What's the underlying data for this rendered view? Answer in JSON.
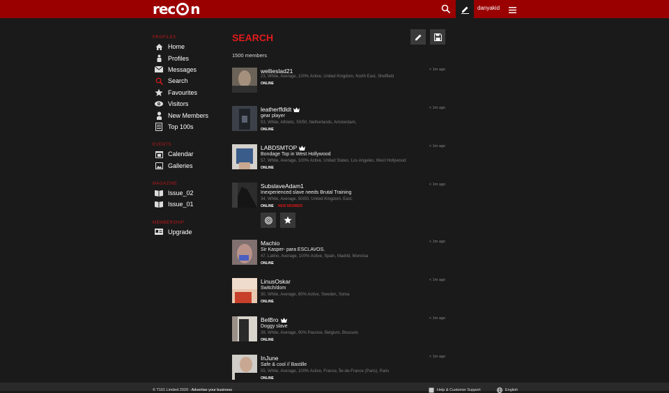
{
  "header": {
    "logo_text": "recon",
    "username": "danyakid"
  },
  "sidebar": {
    "sections": [
      {
        "title": "PROFILES",
        "items": [
          {
            "label": "Home",
            "icon": "home-icon"
          },
          {
            "label": "Profiles",
            "icon": "profiles-icon"
          },
          {
            "label": "Messages",
            "icon": "envelope-icon"
          },
          {
            "label": "Search",
            "icon": "search-icon"
          },
          {
            "label": "Favourites",
            "icon": "star-icon"
          },
          {
            "label": "Visitors",
            "icon": "eye-icon"
          },
          {
            "label": "New Members",
            "icon": "new-member-icon"
          },
          {
            "label": "Top 100s",
            "icon": "list-icon"
          }
        ]
      },
      {
        "title": "EVENTS",
        "items": [
          {
            "label": "Calendar",
            "icon": "calendar-icon"
          },
          {
            "label": "Galleries",
            "icon": "gallery-icon"
          }
        ]
      },
      {
        "title": "MAGAZINE",
        "items": [
          {
            "label": "Issue_02",
            "icon": "magazine-icon"
          },
          {
            "label": "Issue_01",
            "icon": "magazine-icon"
          }
        ]
      },
      {
        "title": "MEMBERSHIP",
        "items": [
          {
            "label": "Upgrade",
            "icon": "id-card-icon"
          }
        ]
      }
    ]
  },
  "main": {
    "title": "SEARCH",
    "count": "1500 members",
    "members": [
      {
        "name": "wellieslad21",
        "tagline": "",
        "details": "23, White, Average, 100% Active, United Kingdom, North East, Sheffield",
        "status": "ONLINE",
        "new": "",
        "time": "< 1m ago",
        "crown": false,
        "thumb_color": "#5a5750"
      },
      {
        "name": "leatherffdldt",
        "tagline": "gear player",
        "details": "53, White, Athletic, 50/50, Netherlands, Amsterdam,",
        "status": "ONLINE",
        "new": "",
        "time": "< 1m ago",
        "crown": true,
        "thumb_color": "#44484f"
      },
      {
        "name": "LABDSMTOP",
        "tagline": "Bondage Top in West Hollywood",
        "details": "57, White, Average, 100% Active, United States, Los Angeles, West Hollywood",
        "status": "ONLINE",
        "new": "",
        "time": "< 1m ago",
        "crown": true,
        "thumb_color": "#3d5578"
      },
      {
        "name": "SubslaveAdam1",
        "tagline": "Inexperienced slave needs Brutal Training",
        "details": "34, White, Average, 50/50, United Kingdom, East,",
        "status": "ONLINE",
        "new": "NEW MEMBER",
        "time": "< 1m ago",
        "crown": false,
        "thumb_color": "#2a2a2a"
      },
      {
        "name": "Machio",
        "tagline": "Sir Kasper- para ESCLAVOS.",
        "details": "47, Latino, Average, 100% Active, Spain, Madrid, Moncloa",
        "status": "ONLINE",
        "new": "",
        "time": "< 1m ago",
        "crown": false,
        "thumb_color": "#8a7a78"
      },
      {
        "name": "LinusOskar",
        "tagline": "Switch/dom",
        "details": "30, White, Average, 80% Active, Sweden, Solna",
        "status": "ONLINE",
        "new": "",
        "time": "< 1m ago",
        "crown": false,
        "thumb_color": "#d8b8a0"
      },
      {
        "name": "BelBro",
        "tagline": "Doggy slave",
        "details": "39, White, Average, 90% Passive, Belgium, Brussels",
        "status": "ONLINE",
        "new": "",
        "time": "< 1m ago",
        "crown": true,
        "thumb_color": "#55504a"
      },
      {
        "name": "InJune",
        "tagline": "Safe & cool // Bastille",
        "details": "55, White, Average, 100% Active, France, Île-de-France (Paris), Paris",
        "status": "ONLINE",
        "new": "",
        "time": "< 1m ago",
        "crown": false,
        "thumb_color": "#c8c0b8"
      }
    ]
  },
  "footer": {
    "copyright": "© T101 Limited 2020 - ",
    "advertise": "Advertise your business",
    "help": "Help & Customer Support",
    "language": "English"
  },
  "colors": {
    "accent": "#9b0000",
    "title_red": "#e01b1b"
  }
}
